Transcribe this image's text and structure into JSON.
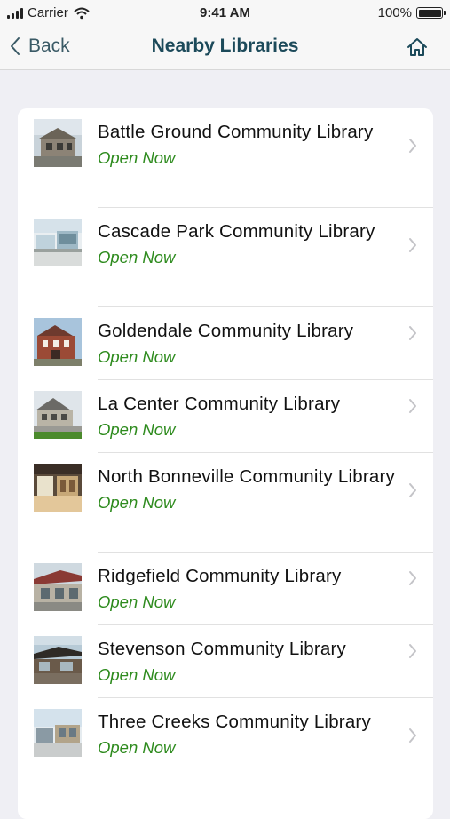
{
  "status_bar": {
    "carrier": "Carrier",
    "time": "9:41 AM",
    "battery": "100%"
  },
  "nav": {
    "back_label": "Back",
    "title": "Nearby Libraries"
  },
  "libraries": [
    {
      "name": "Battle Ground Community Library",
      "status": "Open Now"
    },
    {
      "name": "Cascade Park Community Library",
      "status": "Open Now"
    },
    {
      "name": "Goldendale Community Library",
      "status": "Open Now"
    },
    {
      "name": "La Center Community Library",
      "status": "Open Now"
    },
    {
      "name": "North Bonneville Community Library",
      "status": "Open Now"
    },
    {
      "name": "Ridgefield Community Library",
      "status": "Open Now"
    },
    {
      "name": "Stevenson Community Library",
      "status": "Open Now"
    },
    {
      "name": "Three Creeks Community Library",
      "status": "Open Now"
    }
  ],
  "colors": {
    "accent": "#1c4a5a",
    "open_status": "#2e8b1e",
    "background": "#efeff4"
  }
}
